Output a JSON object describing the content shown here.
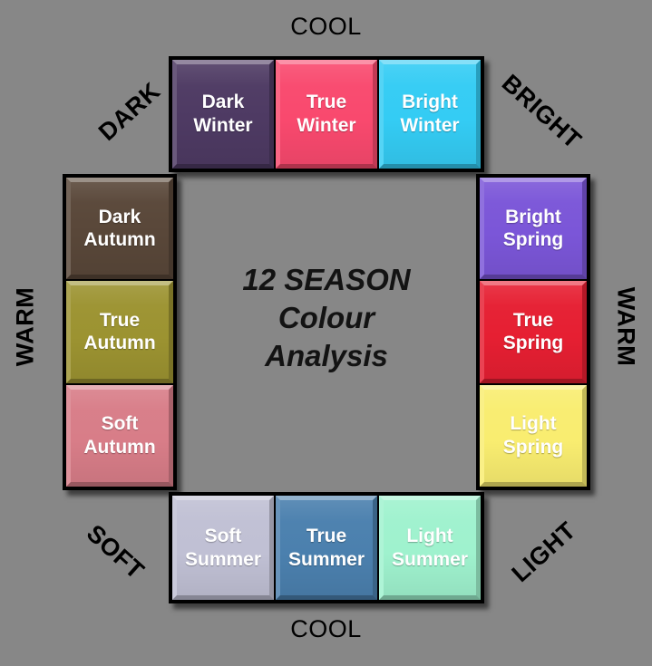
{
  "background_color": "#878787",
  "centre_title": {
    "line1": "12 SEASON",
    "line2": "Colour",
    "line3": "Analysis"
  },
  "axes": {
    "top": "COOL",
    "bottom": "COOL",
    "left": "WARM",
    "right": "WARM",
    "top_left": "DARK",
    "top_right": "BRIGHT",
    "bottom_left": "SOFT",
    "bottom_right": "LIGHT"
  },
  "groups": {
    "winter": {
      "name": "Winter",
      "orientation": "horizontal",
      "tiles": [
        {
          "label": "Dark\nWinter",
          "name": "dark-winter",
          "color": "#4E3A63",
          "text_color": "#ffffff"
        },
        {
          "label": "True\nWinter",
          "name": "true-winter",
          "color": "#F9496E",
          "text_color": "#ffffff"
        },
        {
          "label": "Bright\nWinter",
          "name": "bright-winter",
          "color": "#34CCF4",
          "text_color": "#ffffff"
        }
      ]
    },
    "autumn": {
      "name": "Autumn",
      "orientation": "vertical",
      "tiles": [
        {
          "label": "Dark\nAutumn",
          "name": "dark-autumn",
          "color": "#594739",
          "text_color": "#ffffff"
        },
        {
          "label": "True\nAutumn",
          "name": "true-autumn",
          "color": "#9C9331",
          "text_color": "#ffffff"
        },
        {
          "label": "Soft\nAutumn",
          "name": "soft-autumn",
          "color": "#D87D88",
          "text_color": "#ffffff"
        }
      ]
    },
    "spring": {
      "name": "Spring",
      "orientation": "vertical",
      "tiles": [
        {
          "label": "Bright\nSpring",
          "name": "bright-spring",
          "color": "#7B56D8",
          "text_color": "#ffffff"
        },
        {
          "label": "True\nSpring",
          "name": "true-spring",
          "color": "#E61F32",
          "text_color": "#ffffff"
        },
        {
          "label": "Light\nSpring",
          "name": "light-spring",
          "color": "#F9ED70",
          "text_color": "#ffffff"
        }
      ]
    },
    "summer": {
      "name": "Summer",
      "orientation": "horizontal",
      "tiles": [
        {
          "label": "Soft\nSummer",
          "name": "soft-summer",
          "color": "#C0C0D4",
          "text_color": "#ffffff"
        },
        {
          "label": "True\nSummer",
          "name": "true-summer",
          "color": "#4B80AE",
          "text_color": "#ffffff"
        },
        {
          "label": "Light\nSummer",
          "name": "light-summer",
          "color": "#9FF2CE",
          "text_color": "#ffffff"
        }
      ]
    }
  }
}
